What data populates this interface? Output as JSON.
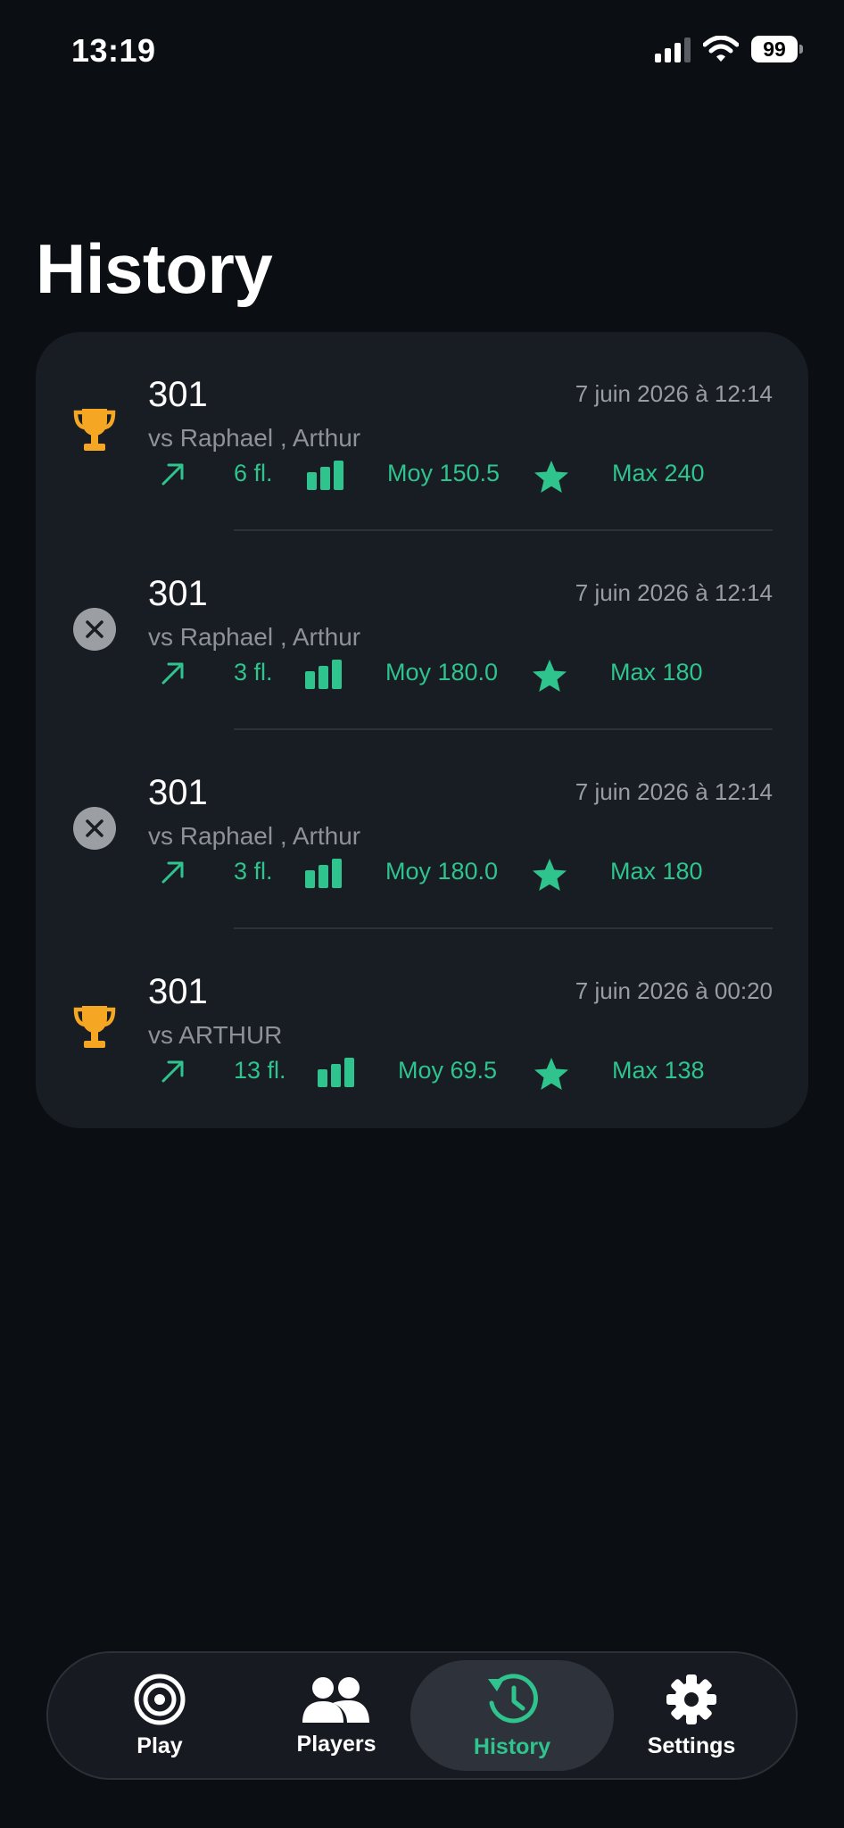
{
  "status_bar": {
    "time": "13:19",
    "battery": "99"
  },
  "page_title": "History",
  "colors": {
    "accent": "#2fc48d",
    "trophy": "#f5a623",
    "loss": "#9b9ea3",
    "background": "#0b0e13",
    "card": "#181c23"
  },
  "games": [
    {
      "result": "win",
      "result_icon": "trophy-icon",
      "title": "301",
      "date": "7 juin 2026 à 12:14",
      "opponents": "vs Raphael , Arthur",
      "darts": "6 fl.",
      "average": "Moy 150.5",
      "max": "Max 240"
    },
    {
      "result": "loss",
      "result_icon": "close-circle-icon",
      "title": "301",
      "date": "7 juin 2026 à 12:14",
      "opponents": "vs Raphael , Arthur",
      "darts": "3 fl.",
      "average": "Moy 180.0",
      "max": "Max 180"
    },
    {
      "result": "loss",
      "result_icon": "close-circle-icon",
      "title": "301",
      "date": "7 juin 2026 à 12:14",
      "opponents": "vs Raphael , Arthur",
      "darts": "3 fl.",
      "average": "Moy 180.0",
      "max": "Max 180"
    },
    {
      "result": "win",
      "result_icon": "trophy-icon",
      "title": "301",
      "date": "7 juin 2026 à 00:20",
      "opponents": "vs ARTHUR",
      "darts": "13 fl.",
      "average": "Moy 69.5",
      "max": "Max 138"
    }
  ],
  "tabs": [
    {
      "label": "Play",
      "icon": "target-icon"
    },
    {
      "label": "Players",
      "icon": "people-icon"
    },
    {
      "label": "History",
      "icon": "history-clock-icon",
      "active": true
    },
    {
      "label": "Settings",
      "icon": "gear-icon"
    }
  ]
}
